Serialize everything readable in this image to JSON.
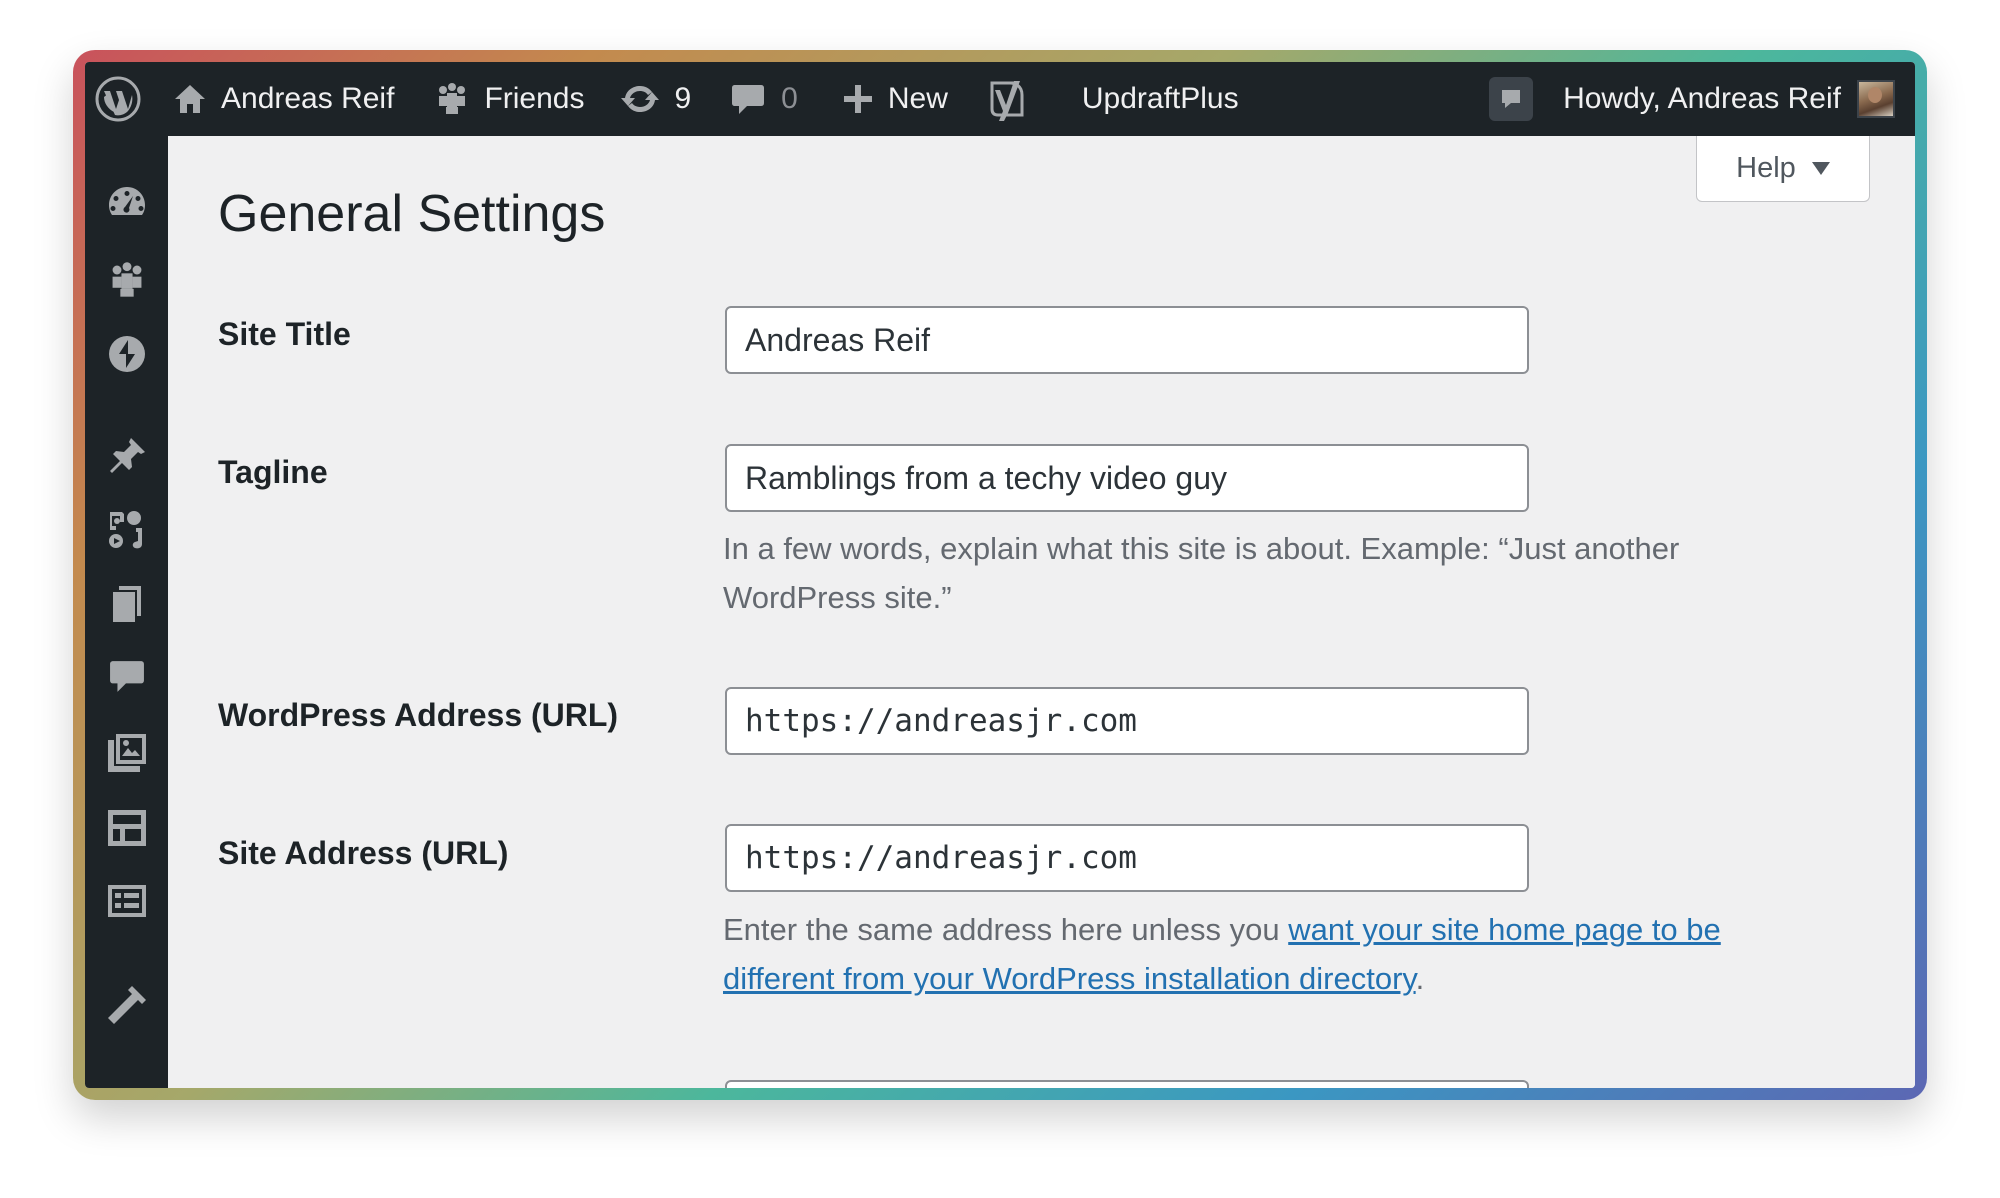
{
  "adminbar": {
    "site_name": "Andreas Reif",
    "friends_label": "Friends",
    "updates_count": "9",
    "comments_count": "0",
    "new_label": "New",
    "updraft_label": "UpdraftPlus",
    "howdy_label": "Howdy, Andreas Reif"
  },
  "help": {
    "label": "Help"
  },
  "page": {
    "title": "General Settings"
  },
  "settings": {
    "site_title": {
      "label": "Site Title",
      "value": "Andreas Reif"
    },
    "tagline": {
      "label": "Tagline",
      "value": "Ramblings from a techy video guy",
      "description": "In a few words, explain what this site is about. Example: “Just another WordPress site.”"
    },
    "wp_address": {
      "label": "WordPress Address (URL)",
      "value": "https://andreasjr.com"
    },
    "site_address": {
      "label": "Site Address (URL)",
      "value": "https://andreasjr.com",
      "description_prefix": "Enter the same address here unless you ",
      "description_link": "want your site home page to be different from your WordPress installation directory",
      "description_suffix": "."
    }
  },
  "icons": {
    "topbar": [
      "wordpress-logo-icon",
      "home-icon",
      "friends-icon",
      "updates-icon",
      "comments-icon",
      "plus-icon",
      "yoast-icon",
      "notifications-icon"
    ],
    "sidebar": [
      "dashboard-icon",
      "friends-icon",
      "jetpack-icon",
      "posts-pin-icon",
      "media-icon",
      "pages-icon",
      "comments-icon",
      "portfolio-icon",
      "blocks-icon",
      "forms-icon",
      "tools-icon"
    ]
  },
  "colors": {
    "adminbar_bg": "#1d2327",
    "content_bg": "#f0f0f1",
    "link": "#2271b1",
    "description_text": "#646970"
  }
}
